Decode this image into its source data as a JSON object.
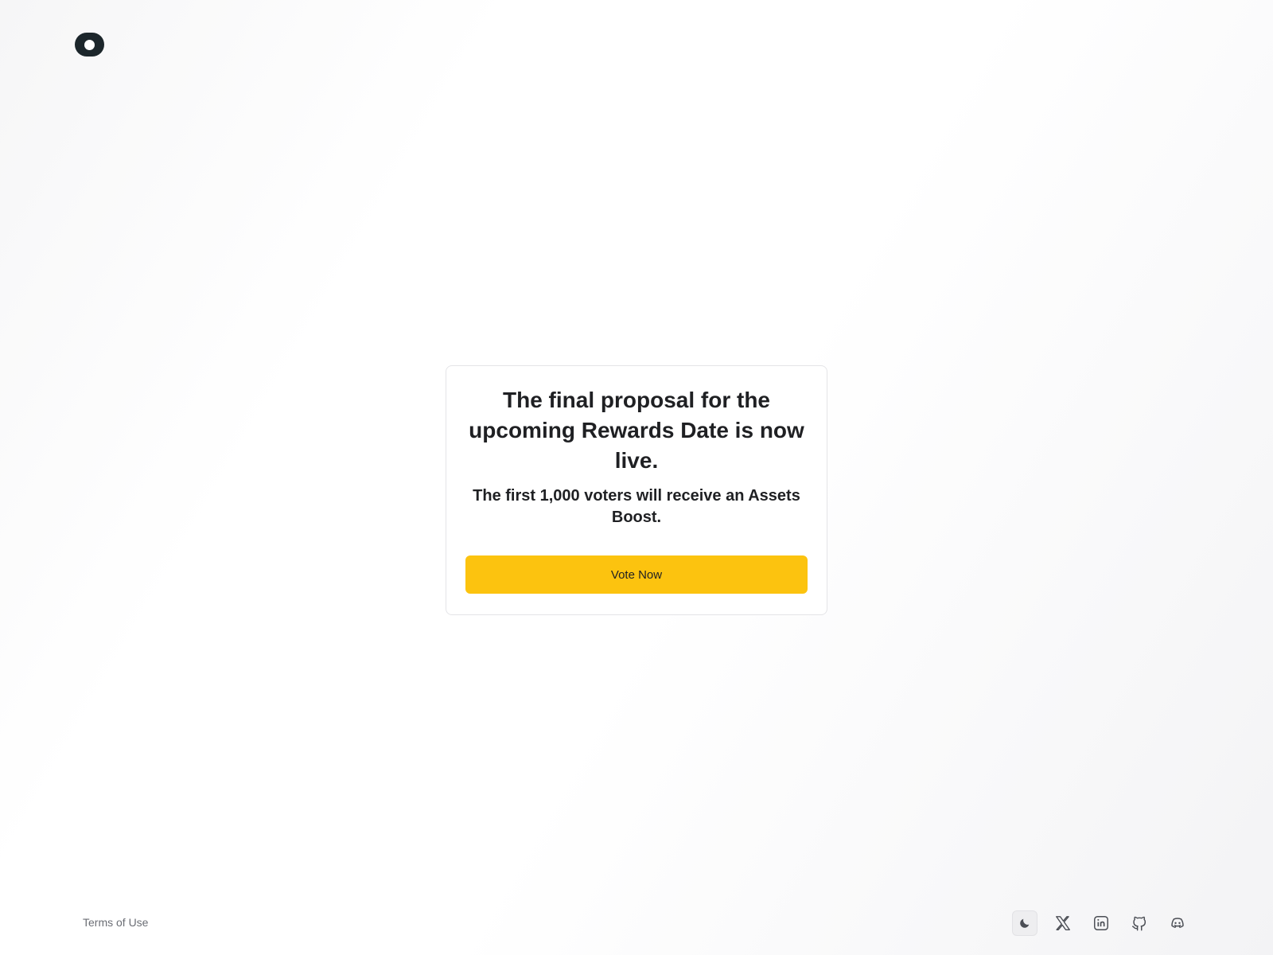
{
  "header": {
    "logo_icon": "toggle-logo-icon"
  },
  "card": {
    "title": "The final proposal for the upcoming Rewards Date is now live.",
    "subtitle": "The first 1,000 voters will receive an Assets Boost.",
    "button_label": "Vote Now",
    "button_color": "#fcc30f"
  },
  "footer": {
    "terms_label": "Terms of Use",
    "icons": [
      "moon-icon",
      "x-icon",
      "linkedin-icon",
      "github-icon",
      "discord-icon"
    ]
  }
}
